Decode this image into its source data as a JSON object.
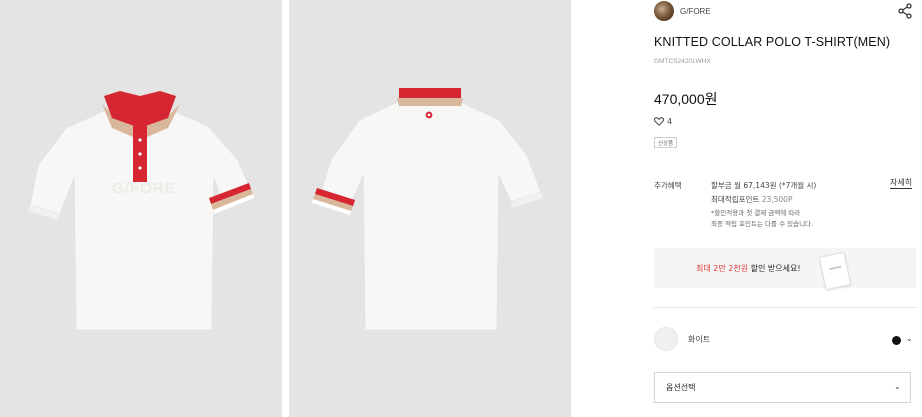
{
  "colors": {
    "panel_bg": "#e4e4e4",
    "shirt": "#f7f7f5",
    "collar_red": "#d62631",
    "collar_beige": "#d8b79a",
    "promo_accent": "#e03b3b"
  },
  "gallery": {
    "front_chest_print": "G/FORE"
  },
  "brand": {
    "name": "G/FORE",
    "share_icon": "share-icon"
  },
  "product": {
    "title": "KNITTED COLLAR POLO T-SHIRT(MEN)",
    "sku": "GMTCS24201WHX",
    "price": "470,000원",
    "like_icon": "heart-icon",
    "likes": "4",
    "tag": "신상품"
  },
  "benefits": {
    "label": "추가혜택",
    "line1": "할부금 월 67,143원 (*7개월 시)",
    "line2_label": "최대적립포인트",
    "line2_points": "23,500P",
    "note1": "*할인적용과 첫 결제 금액에 따라",
    "note2": "최종 적립 포인트는 다를 수 있습니다.",
    "detail_link": "자세히"
  },
  "promo": {
    "prefix": "최대 ",
    "highlight": "2만 2천원",
    "suffix": " 할인 받으세요!"
  },
  "color_option": {
    "name": "화이트",
    "selected_swatch": "#111111",
    "caret": "⌄"
  },
  "option_select": {
    "label": "옵션선택",
    "caret": "⌄"
  }
}
